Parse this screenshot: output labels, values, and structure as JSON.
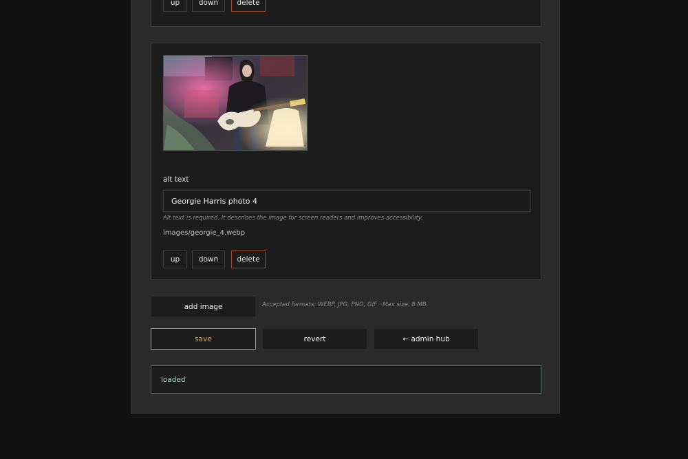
{
  "previous_card": {
    "up_label": "up",
    "down_label": "down",
    "delete_label": "delete"
  },
  "image_card": {
    "alt_label": "alt text",
    "alt_value": "Georgie Harris photo 4",
    "alt_hint": "Alt text is required. It describes the image for screen readers and improves accessibility.",
    "file_path": "images/georgie_4.webp",
    "up_label": "up",
    "down_label": "down",
    "delete_label": "delete"
  },
  "add_image": {
    "label": "add image",
    "formats_hint": "Accepted formats: WEBP, JPG, PNG, GIF · Max size: 8 MB."
  },
  "actions": {
    "save_label": "save",
    "revert_label": "revert",
    "admin_hub_label": "← admin hub"
  },
  "status": {
    "text": "loaded"
  },
  "colors": {
    "accent_save": "#d9a35e",
    "delete_border": "#a8482e",
    "status_border": "#4f7a6d",
    "status_text": "#9ed6bf"
  }
}
